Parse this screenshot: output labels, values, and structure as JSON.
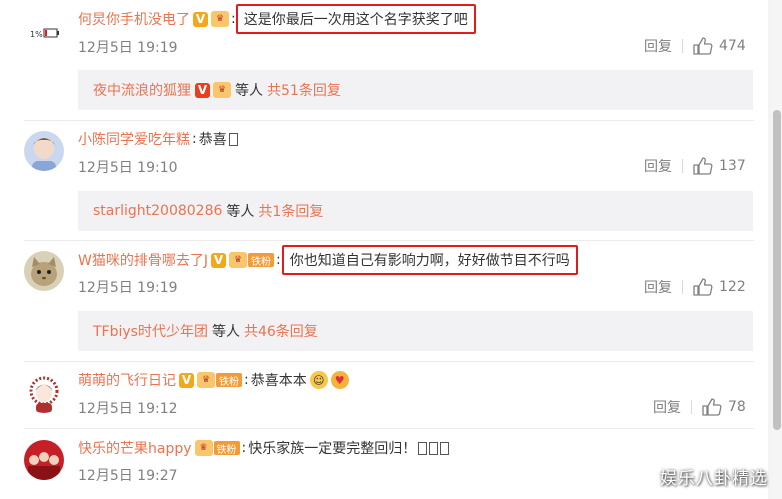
{
  "comments": [
    {
      "username": "何炅你手机没电了",
      "badge_v": "V",
      "text": "这是你最后一次用这个名字获奖了吧",
      "date": "12月5日 19:19",
      "reply_label": "回复",
      "likes": "474",
      "avatar_text": "1%",
      "replies": {
        "name": "夜中流浪的狐狸",
        "badge_v": "V",
        "etc": "等人",
        "total": "共51条回复"
      }
    },
    {
      "username": "小陈同学爱吃年糕",
      "text": "恭喜",
      "date": "12月5日 19:10",
      "reply_label": "回复",
      "likes": "137",
      "replies": {
        "name": "starlight20080286",
        "etc": "等人",
        "total": "共1条回复"
      }
    },
    {
      "username": "W猫咪的排骨哪去了J",
      "badge_v": "V",
      "fan_badge": "铁粉",
      "text": "你也知道自己有影响力啊，好好做节目不行吗",
      "date": "12月5日 19:19",
      "reply_label": "回复",
      "likes": "122",
      "replies": {
        "name": "TFbiys时代少年团",
        "etc": "等人",
        "total": "共46条回复"
      }
    },
    {
      "username": "萌萌的飞行日记",
      "badge_v": "V",
      "fan_badge": "铁粉",
      "text": "恭喜本本",
      "date": "12月5日 19:12",
      "reply_label": "回复",
      "likes": "78"
    },
    {
      "username": "快乐的芒果happy",
      "fan_badge": "铁粉",
      "text": "快乐家族一定要完整回归！",
      "date": "12月5日 19:27"
    }
  ],
  "watermark": "娱乐八卦精选",
  "colors": {
    "username": "#eb7350",
    "highlight": "#e31b1b",
    "reply_bg": "#f2f2f5"
  }
}
